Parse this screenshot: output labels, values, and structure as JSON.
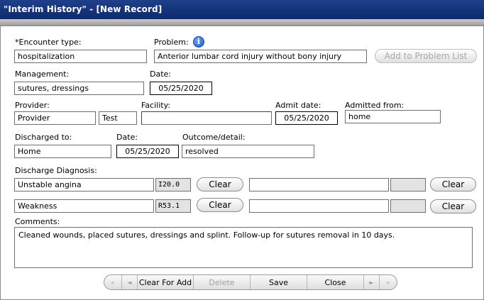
{
  "window": {
    "title": "\"Interim History\" - [New Record]"
  },
  "encounter": {
    "label": "*Encounter type:",
    "value": "hospitalization"
  },
  "problem": {
    "label": "Problem:",
    "value": "Anterior lumbar cord injury without bony injury",
    "add_button": "Add to Problem List"
  },
  "management": {
    "label": "Management:",
    "value": "sutures, dressings"
  },
  "management_date": {
    "label": "Date:",
    "value": "05/25/2020"
  },
  "provider": {
    "label": "Provider:",
    "last": "Provider",
    "first": "Test"
  },
  "facility": {
    "label": "Facility:",
    "value": ""
  },
  "admit_date": {
    "label": "Admit date:",
    "value": "05/25/2020"
  },
  "admitted_from": {
    "label": "Admitted from:",
    "value": "home"
  },
  "discharged_to": {
    "label": "Discharged to:",
    "value": "Home"
  },
  "discharge_date": {
    "label": "Date:",
    "value": "05/25/2020"
  },
  "outcome": {
    "label": "Outcome/detail:",
    "value": "resolved"
  },
  "discharge_diagnosis": {
    "label": "Discharge Diagnosis:",
    "rows": [
      {
        "left_text": "Unstable angina",
        "left_code": "I20.0",
        "clear": "Clear",
        "right_text": "",
        "right_code": "",
        "right_clear": "Clear"
      },
      {
        "left_text": "Weakness",
        "left_code": "R53.1",
        "clear": "Clear",
        "right_text": "",
        "right_code": "",
        "right_clear": "Clear"
      }
    ]
  },
  "comments": {
    "label": "Comments:",
    "value": "Cleaned wounds, placed sutures, dressings and splint. Follow-up for sutures removal in 10 days."
  },
  "nav": {
    "first": "«",
    "prev": "◄",
    "clear_for_add": "Clear For Add",
    "delete": "Delete",
    "save": "Save",
    "close": "Close",
    "next": "►",
    "last": "»"
  },
  "icons": {
    "info": "info-icon"
  }
}
